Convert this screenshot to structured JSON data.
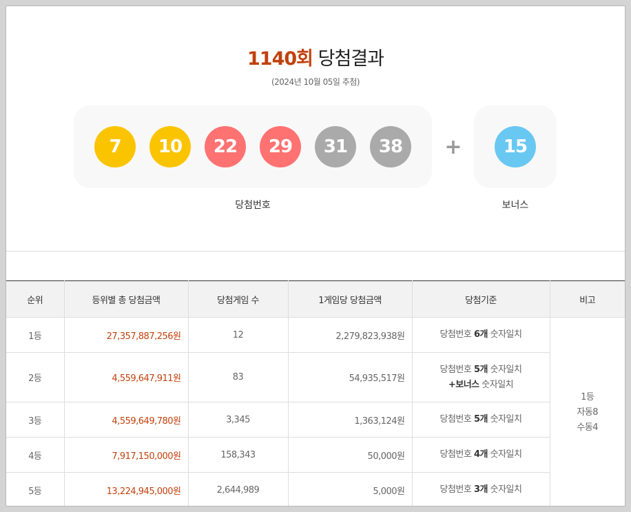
{
  "header": {
    "round": "1140회",
    "title_rest": " 당첨결과",
    "draw_date": "(2024년 10월 05일 추첨)"
  },
  "winning_numbers": [
    {
      "number": "7",
      "color": "#fbc400"
    },
    {
      "number": "10",
      "color": "#fbc400"
    },
    {
      "number": "22",
      "color": "#ff7272"
    },
    {
      "number": "29",
      "color": "#ff7272"
    },
    {
      "number": "31",
      "color": "#aaaaaa"
    },
    {
      "number": "38",
      "color": "#aaaaaa"
    }
  ],
  "bonus": {
    "number": "15",
    "color": "#69c8f2"
  },
  "plus_symbol": "+",
  "captions": {
    "winning": "당첨번호",
    "bonus": "보너스"
  },
  "table": {
    "headers": [
      "순위",
      "등위별 총 당첨금액",
      "당첨게임 수",
      "1게임당 당첨금액",
      "당첨기준",
      "비고"
    ],
    "rows": [
      {
        "rank": "1등",
        "total": "27,357,887,256원",
        "games": "12",
        "per_game": "2,279,823,938원",
        "crit_pre": "당첨번호 ",
        "crit_bold": "6개",
        "crit_post": " 숫자일치",
        "crit_line2": "",
        "crit_line2_bold": ""
      },
      {
        "rank": "2등",
        "total": "4,559,647,911원",
        "games": "83",
        "per_game": "54,935,517원",
        "crit_pre": "당첨번호 ",
        "crit_bold": "5개",
        "crit_post": " 숫자일치",
        "crit_line2_bold": "+보너스",
        "crit_line2": " 숫자일치"
      },
      {
        "rank": "3등",
        "total": "4,559,649,780원",
        "games": "3,345",
        "per_game": "1,363,124원",
        "crit_pre": "당첨번호 ",
        "crit_bold": "5개",
        "crit_post": " 숫자일치",
        "crit_line2": "",
        "crit_line2_bold": ""
      },
      {
        "rank": "4등",
        "total": "7,917,150,000원",
        "games": "158,343",
        "per_game": "50,000원",
        "crit_pre": "당첨번호 ",
        "crit_bold": "4개",
        "crit_post": " 숫자일치",
        "crit_line2": "",
        "crit_line2_bold": ""
      },
      {
        "rank": "5등",
        "total": "13,224,945,000원",
        "games": "2,644,989",
        "per_game": "5,000원",
        "crit_pre": "당첨번호 ",
        "crit_bold": "3개",
        "crit_post": " 숫자일치",
        "crit_line2": "",
        "crit_line2_bold": ""
      }
    ],
    "note": {
      "line1": "1등",
      "line2": "자동8",
      "line3": "수동4"
    }
  }
}
